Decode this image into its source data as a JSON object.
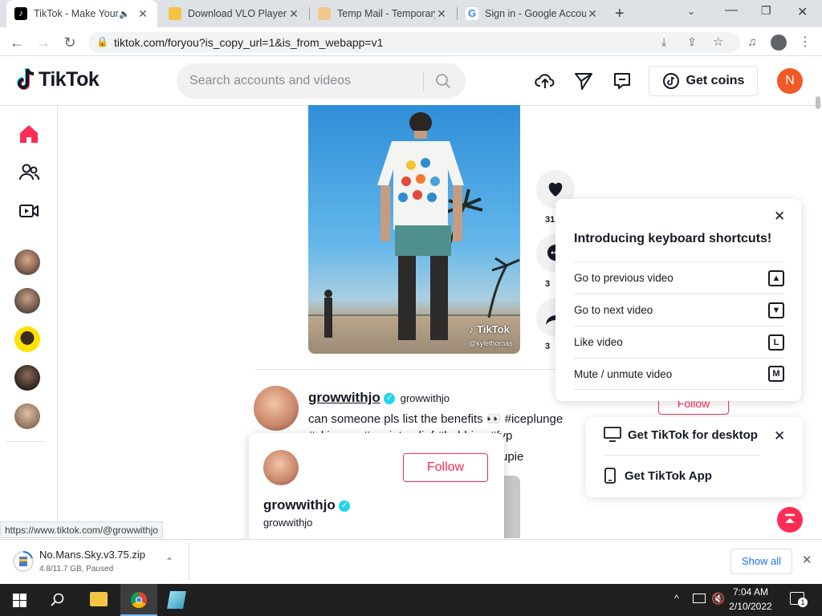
{
  "browser": {
    "tabs": [
      {
        "title": "TikTok - Make Your Day",
        "active": true
      },
      {
        "title": "Download VLO Player",
        "active": false
      },
      {
        "title": "Temp Mail - Temporary Email",
        "active": false
      },
      {
        "title": "Sign in - Google Accounts",
        "active": false
      }
    ],
    "url": "tiktok.com/foryou?is_copy_url=1&is_from_webapp=v1",
    "status_url": "https://www.tiktok.com/@growwithjo"
  },
  "header": {
    "logo": "TikTok",
    "search_placeholder": "Search accounts and videos",
    "get_coins": "Get coins",
    "avatar_initial": "N"
  },
  "video": {
    "watermark": "TikTok",
    "watermark_user": "@kylethomas",
    "counts": [
      "31",
      "3",
      "3"
    ]
  },
  "post": {
    "username": "growwithjo",
    "nickname": "growwithjo",
    "caption_line1": "can someone pls list the benefits 👀 #iceplunge",
    "caption_line2": "#skincare #anxietyrelief #hobbies #fyp",
    "caption_line3": "upie",
    "follow": "Follow"
  },
  "hovercard": {
    "username": "growwithjo",
    "nickname": "growwithjo",
    "follow": "Follow"
  },
  "shortcuts": {
    "title": "Introducing keyboard shortcuts!",
    "items": [
      {
        "label": "Go to previous video",
        "key": "▲"
      },
      {
        "label": "Go to next video",
        "key": "▼"
      },
      {
        "label": "Like video",
        "key": "L"
      },
      {
        "label": "Mute / unmute video",
        "key": "M"
      }
    ]
  },
  "getapp": {
    "desktop": "Get TikTok for desktop",
    "app": "Get TikTok App"
  },
  "download": {
    "filename": "No.Mans.Sky.v3.75.zip",
    "status": "4.8/11.7 GB, Paused",
    "show_all": "Show all"
  },
  "taskbar": {
    "time": "7:04 AM",
    "date": "2/10/2022",
    "notifications": "1"
  },
  "colors": {
    "accent": "#fe2c55",
    "verified": "#20d5ec",
    "avatar": "#f15a24"
  }
}
